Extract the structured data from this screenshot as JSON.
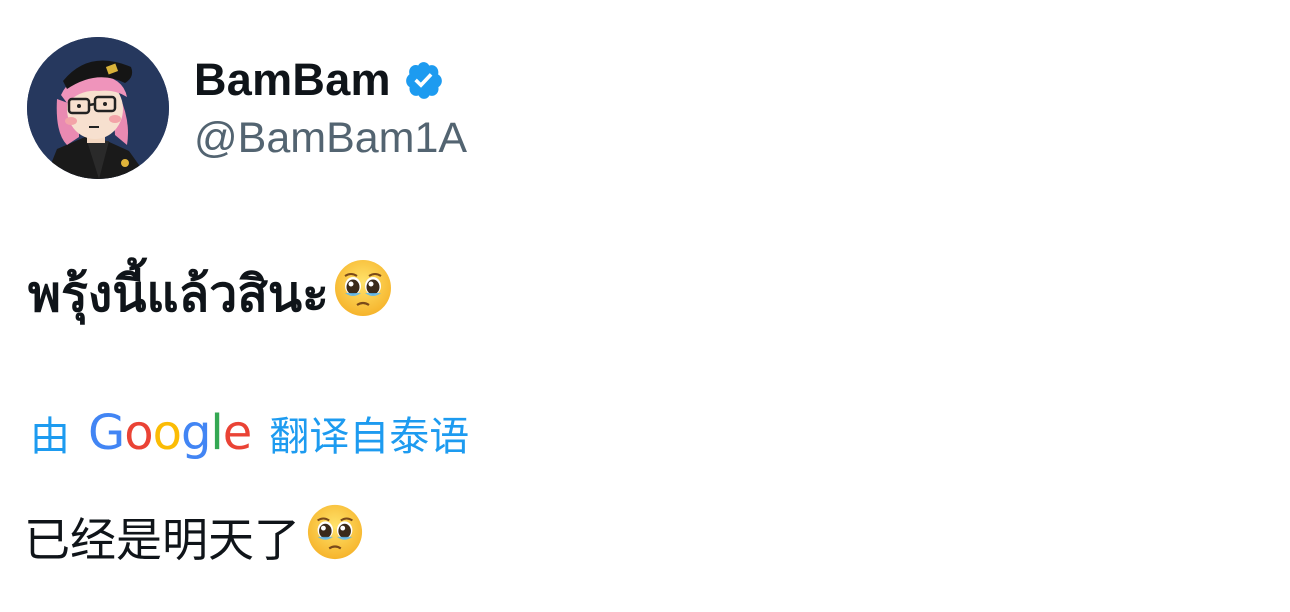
{
  "author": {
    "display_name": "BamBam",
    "handle": "@BamBam1A",
    "verified": true
  },
  "tweet": {
    "text": "พรุ้งนี้แล้วสินะ",
    "emoji": "pleading-face"
  },
  "translation": {
    "prefix": "由",
    "provider_letters": [
      "G",
      "o",
      "o",
      "g",
      "l",
      "e"
    ],
    "suffix": "翻译自泰语",
    "text": "已经是明天了",
    "emoji": "pleading-face"
  },
  "colors": {
    "verified_blue": "#1d9bf0",
    "link_blue": "#1d9bf0",
    "handle_gray": "#536471",
    "text_dark": "#0f1419"
  }
}
